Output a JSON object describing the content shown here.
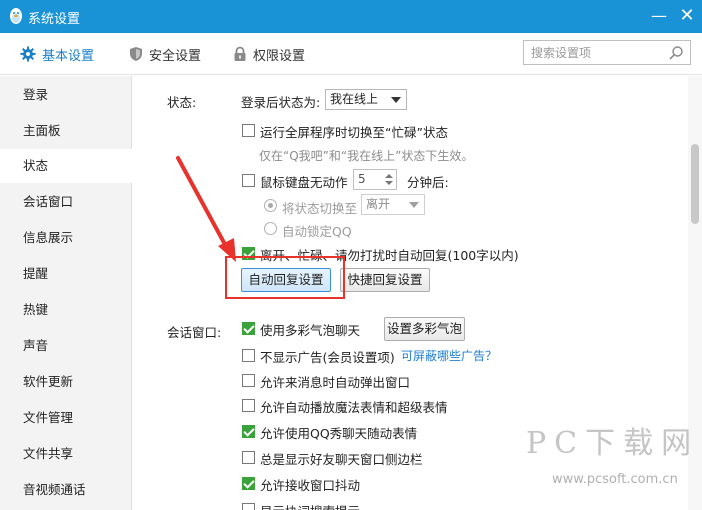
{
  "window": {
    "title": "系统设置",
    "minimize": "—",
    "close": "✕"
  },
  "tabs": [
    {
      "label": "基本设置",
      "icon": "gear-icon"
    },
    {
      "label": "安全设置",
      "icon": "shield-icon"
    },
    {
      "label": "权限设置",
      "icon": "lock-icon"
    }
  ],
  "search": {
    "placeholder": "搜索设置项"
  },
  "sidebar": {
    "items": [
      "登录",
      "主面板",
      "状态",
      "会话窗口",
      "信息展示",
      "提醒",
      "热键",
      "声音",
      "软件更新",
      "文件管理",
      "文件共享",
      "音视频通话"
    ],
    "active": "状态"
  },
  "status_section": {
    "label": "状态:",
    "login_status_label": "登录后状态为:",
    "login_status_value": "我在线上",
    "fullscreen_busy": {
      "label": "运行全屏程序时切换至“忙碌”状态",
      "checked": false
    },
    "fullscreen_hint": "仅在“Q我吧”和“我在线上”状态下生效。",
    "idle": {
      "label": "鼠标键盘无动作",
      "checked": false,
      "minutes": "5",
      "suffix": "分钟后:"
    },
    "idle_switch": {
      "label": "将状态切换至",
      "value": "离开",
      "selected": true
    },
    "idle_lock": {
      "label": "自动锁定QQ",
      "selected": false
    },
    "auto_reply": {
      "label": "离开、忙碌、请勿打扰时自动回复(100字以内)",
      "checked": true
    },
    "auto_reply_button": "自动回复设置",
    "quick_reply_button": "快捷回复设置"
  },
  "chat_section": {
    "label": "会话窗口:",
    "items": [
      {
        "label": "使用多彩气泡聊天",
        "checked": true
      },
      {
        "label": "不显示广告(会员设置项)",
        "checked": false
      },
      {
        "label": "允许来消息时自动弹出窗口",
        "checked": false
      },
      {
        "label": "允许自动播放魔法表情和超级表情",
        "checked": false
      },
      {
        "label": "允许使用QQ秀聊天随动表情",
        "checked": true
      },
      {
        "label": "总是显示好友聊天窗口侧边栏",
        "checked": false
      },
      {
        "label": "允许接收窗口抖动",
        "checked": true
      },
      {
        "label": "显示协词搜索提示",
        "checked": false
      }
    ],
    "bubble_button": "设置多彩气泡",
    "ads_link": "可屏蔽哪些广告？"
  },
  "watermark": {
    "brand": "PC下载网",
    "url": "www.pcsoft.com.cn"
  },
  "colors": {
    "titlebar": "#1a93d6",
    "accent": "#1a7fc8",
    "check": "#3aa23a",
    "annotation": "#e8322c"
  }
}
